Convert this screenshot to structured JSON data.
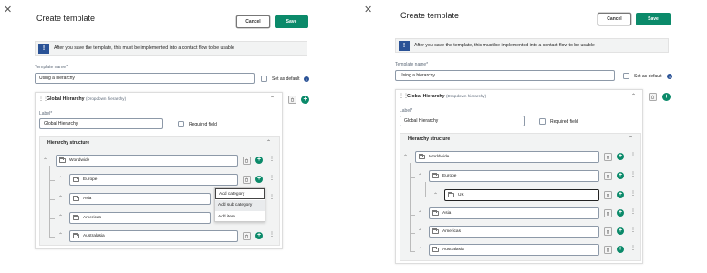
{
  "dialog_title": "Create template",
  "cancel_label": "Cancel",
  "save_label": "Save",
  "banner_text": "After you save the template, this must be implemented into a contact flow to be usable",
  "template_name_label": "Template name*",
  "template_name_value": "Using a hierarchy",
  "set_as_default_label": "Set as default",
  "card_title": "Global Hierarchy",
  "card_subtitle": "(Dropdown hierarchy)",
  "label_field_label": "Label*",
  "label_field_value": "Global Hierarchy",
  "required_field_label": "Required field",
  "hierarchy_title": "Hierarchy structure",
  "nodes_before": [
    "Worldwide",
    "Europe",
    "Asia",
    "Americas",
    "Australasia"
  ],
  "nodes_after": [
    "Worldwide",
    "Europe",
    "UK",
    "Asia",
    "Americas",
    "Australasia"
  ],
  "context_menu": [
    "Add category",
    "Add sub category",
    "Add item"
  ],
  "icons": {
    "close": "close-icon",
    "warning": "warning-icon",
    "info": "info-icon",
    "drag": "drag-handle-icon",
    "collapse": "chevron-up-icon",
    "delete": "trash-icon",
    "add": "plus-circle-icon",
    "more": "more-vertical-icon",
    "folder": "folder-icon"
  },
  "colors": {
    "primary": "#0b8a6a",
    "info_blue": "#2a5296"
  }
}
